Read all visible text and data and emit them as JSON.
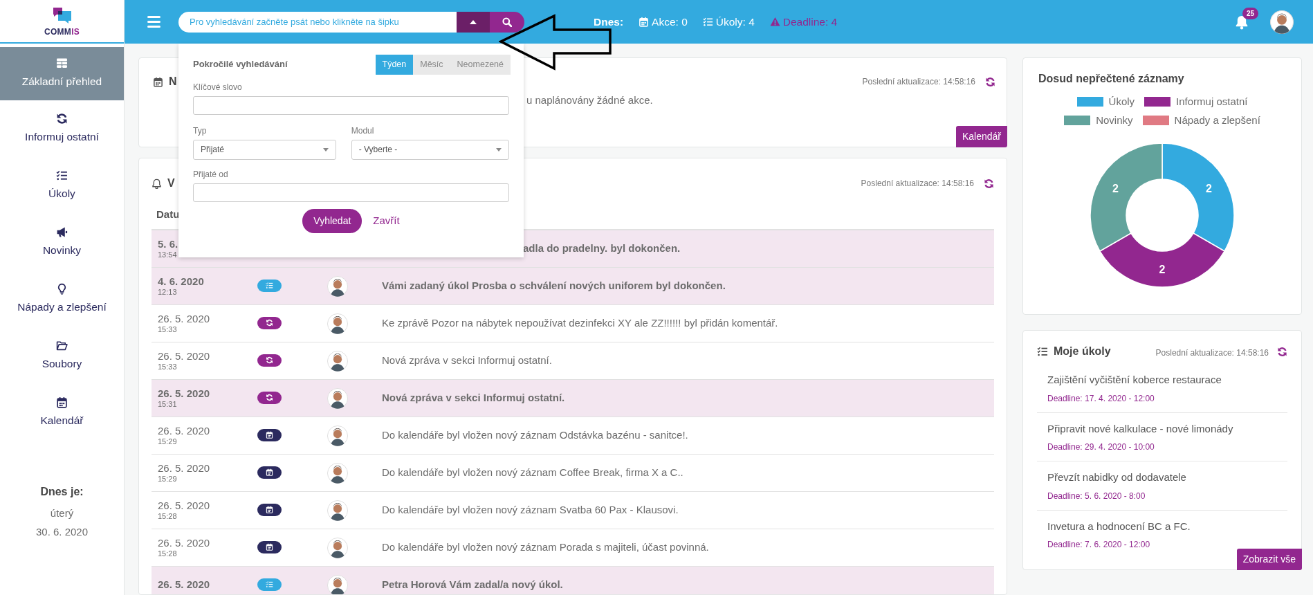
{
  "sidebar": {
    "logo": {
      "parts": [
        {
          "text": "COMM",
          "color": "#2b2a5e"
        },
        {
          "text": "IS",
          "color": "#92278f"
        }
      ]
    },
    "items": [
      {
        "kind": "overview",
        "label": "Základní přehled",
        "selected": true
      },
      {
        "kind": "inform",
        "label": "Informuj ostatní",
        "selected": false
      },
      {
        "kind": "tasks",
        "label": "Úkoly",
        "selected": false
      },
      {
        "kind": "news",
        "label": "Novinky",
        "selected": false
      },
      {
        "kind": "ideas",
        "label": "Nápady a zlepšení",
        "selected": false
      },
      {
        "kind": "files",
        "label": "Soubory",
        "selected": false
      },
      {
        "kind": "calendar",
        "label": "Kalendář",
        "selected": false
      }
    ],
    "today": {
      "heading": "Dnes je:",
      "weekday": "úterý",
      "date": "30. 6. 2020"
    }
  },
  "header": {
    "search": {
      "placeholder": "Pro vyhledávání začněte psát nebo klikněte na šipku"
    },
    "today_label": "Dnes:",
    "stats": [
      {
        "kind": "events",
        "text": "Akce: 0"
      },
      {
        "kind": "tasks",
        "text": "Úkoly: 4"
      },
      {
        "kind": "deadline",
        "text": "Deadline: 4"
      }
    ],
    "notifications": "25"
  },
  "advanced_search": {
    "title": "Pokročilé vyhledávání",
    "periods": [
      {
        "label": "Týden",
        "selected": true
      },
      {
        "label": "Měsíc",
        "selected": false
      },
      {
        "label": "Neomezené",
        "selected": false
      }
    ],
    "keyword": {
      "label": "Klíčové slovo"
    },
    "type": {
      "label": "Typ",
      "value": "Přijaté"
    },
    "module": {
      "label": "Modul",
      "value": "- Vyberte -"
    },
    "received_from": {
      "label": "Přijaté od"
    },
    "search_button": "Vyhledat",
    "close_link": "Zavřít"
  },
  "events_card": {
    "title": "N",
    "updated": "Poslední aktualizace: 14:58:16",
    "text": "u naplánovány žádné akce.",
    "button": "Kalendář"
  },
  "feed_card": {
    "title": "V",
    "updated": "Poslední aktualizace: 14:58:16",
    "columns": [
      "Datu"
    ],
    "rows": [
      {
        "date": "5. 6.",
        "time": "13:54",
        "unread": true,
        "text": "adla do pradelny. byl dokončen."
      },
      {
        "date": "4. 6. 2020",
        "time": "12:13",
        "kind": "tasks",
        "unread": true,
        "text": "Vámi zadaný úkol Prosba o schválení nových uniforem byl dokončen."
      },
      {
        "date": "26. 5. 2020",
        "time": "15:33",
        "kind": "inform",
        "unread": false,
        "text": "Ke zprávě Pozor na nábytek nepoužívat dezinfekci XY ale ZZ!!!!!! byl přidán komentář."
      },
      {
        "date": "26. 5. 2020",
        "time": "15:33",
        "kind": "inform",
        "unread": false,
        "text": "Nová zpráva v sekci Informuj ostatní."
      },
      {
        "date": "26. 5. 2020",
        "time": "15:31",
        "kind": "inform",
        "unread": true,
        "text": "Nová zpráva v sekci Informuj ostatní."
      },
      {
        "date": "26. 5. 2020",
        "time": "15:29",
        "kind": "calendar",
        "unread": false,
        "text": "Do kalendáře byl vložen nový záznam Odstávka bazénu - sanitce!."
      },
      {
        "date": "26. 5. 2020",
        "time": "15:29",
        "kind": "calendar",
        "unread": false,
        "text": "Do kalendáře byl vložen nový záznam Coffee Break, firma X a C.."
      },
      {
        "date": "26. 5. 2020",
        "time": "15:28",
        "kind": "calendar",
        "unread": false,
        "text": "Do kalendáře byl vložen nový záznam Svatba 60 Pax - Klausovi."
      },
      {
        "date": "26. 5. 2020",
        "time": "15:28",
        "kind": "calendar",
        "unread": false,
        "text": "Do kalendáře byl vložen nový záznam Porada s majiteli, účast povinná."
      },
      {
        "date": "26. 5. 2020",
        "kind": "tasks",
        "unread": true,
        "text": "Petra Horová Vám zadal/a nový úkol."
      }
    ]
  },
  "unread_card": {
    "title": "Dosud nepřečtené záznamy",
    "legend": [
      {
        "color": "#33aadf"
      },
      {
        "color": "#92278f"
      },
      {
        "color": "#62a39c"
      },
      {
        "color": "#e07a83"
      }
    ],
    "chart_data": {
      "type": "donut",
      "categories": [
        "Úkoly",
        "Informuj ostatní",
        "Novinky",
        "Nápady a zlepšení"
      ],
      "values": [
        2,
        2,
        2,
        0
      ],
      "data_labels": true
    }
  },
  "tasks_card": {
    "title": "Moje úkoly",
    "updated": "Poslední aktualizace: 14:58:16",
    "items": [
      {
        "title": "Zajištění vyčištění koberce restaurace",
        "deadline": "Deadline: 17. 4. 2020 - 12:00"
      },
      {
        "title": "Připravit nové kalkulace - nové limonády",
        "deadline": "Deadline: 29. 4. 2020 - 10:00"
      },
      {
        "title": "Převzít nabidky od dodavatele",
        "deadline": "Deadline: 5. 6. 2020 - 8:00"
      },
      {
        "title": "Invetura a hodnocení BC a FC.",
        "deadline": "Deadline: 7. 6. 2020 - 12:00"
      }
    ],
    "button": "Zobrazit vše"
  }
}
